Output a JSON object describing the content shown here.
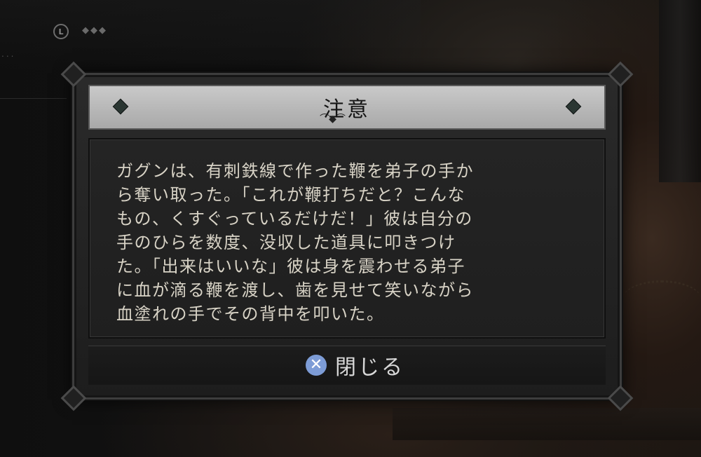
{
  "hud": {
    "badge_label": "L",
    "indicator": "◆◆◆",
    "dots": "..."
  },
  "dialog": {
    "title": "注意",
    "ornament": "⌒◆⌒",
    "body_lines": [
      "ガグンは、有刺鉄線で作った鞭を弟子の手か",
      "ら奪い取った。「これが鞭打ちだと？こんな",
      "もの、くすぐっているだけだ！」彼は自分の",
      "手のひらを数度、没収した道具に叩きつけ",
      "た。「出来はいいな」彼は身を震わせる弟子",
      "に血が滴る鞭を渡し、歯を見せて笑いながら",
      "血塗れの手でその背中を叩いた。"
    ],
    "close_button": {
      "icon": "cross-button-icon",
      "glyph": "✕",
      "label": "閉じる"
    }
  },
  "colors": {
    "title_bar": "#bcbcbc",
    "body_text": "#d8d3c6",
    "cross_button": "#7d9cd6"
  }
}
